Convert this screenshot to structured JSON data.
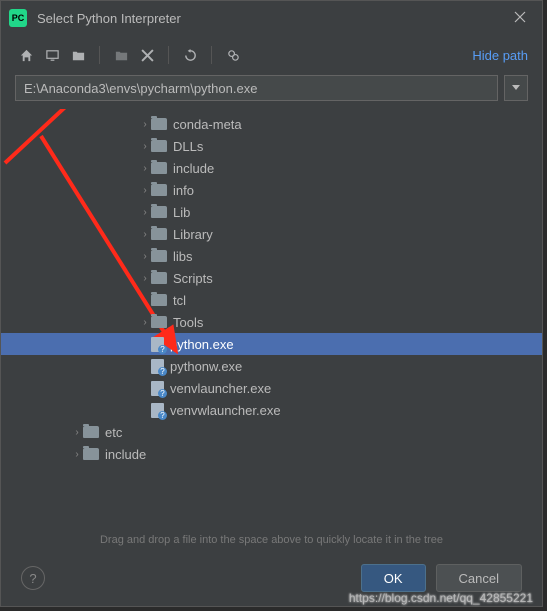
{
  "window": {
    "title": "Select Python Interpreter"
  },
  "toolbar": {
    "hide_path": "Hide path"
  },
  "path": {
    "value": "E:\\Anaconda3\\envs\\pycharm\\python.exe"
  },
  "tree": {
    "items": [
      {
        "depth": 3,
        "expandable": true,
        "icon": "folder",
        "label": "conda-meta",
        "selected": false
      },
      {
        "depth": 3,
        "expandable": true,
        "icon": "folder",
        "label": "DLLs",
        "selected": false
      },
      {
        "depth": 3,
        "expandable": true,
        "icon": "folder",
        "label": "include",
        "selected": false
      },
      {
        "depth": 3,
        "expandable": true,
        "icon": "folder",
        "label": "info",
        "selected": false
      },
      {
        "depth": 3,
        "expandable": true,
        "icon": "folder",
        "label": "Lib",
        "selected": false
      },
      {
        "depth": 3,
        "expandable": true,
        "icon": "folder",
        "label": "Library",
        "selected": false
      },
      {
        "depth": 3,
        "expandable": true,
        "icon": "folder",
        "label": "libs",
        "selected": false
      },
      {
        "depth": 3,
        "expandable": true,
        "icon": "folder",
        "label": "Scripts",
        "selected": false
      },
      {
        "depth": 3,
        "expandable": true,
        "icon": "folder",
        "label": "tcl",
        "selected": false
      },
      {
        "depth": 3,
        "expandable": true,
        "icon": "folder",
        "label": "Tools",
        "selected": false
      },
      {
        "depth": 3,
        "expandable": false,
        "icon": "file",
        "label": "python.exe",
        "selected": true
      },
      {
        "depth": 3,
        "expandable": false,
        "icon": "file",
        "label": "pythonw.exe",
        "selected": false
      },
      {
        "depth": 3,
        "expandable": false,
        "icon": "file",
        "label": "venvlauncher.exe",
        "selected": false
      },
      {
        "depth": 3,
        "expandable": false,
        "icon": "file",
        "label": "venvwlauncher.exe",
        "selected": false
      },
      {
        "depth": 1,
        "expandable": true,
        "icon": "folder",
        "label": "etc",
        "selected": false
      },
      {
        "depth": 1,
        "expandable": true,
        "icon": "folder",
        "label": "include",
        "selected": false
      }
    ],
    "hint": "Drag and drop a file into the space above to quickly locate it in the tree"
  },
  "buttons": {
    "ok": "OK",
    "cancel": "Cancel",
    "help": "?"
  },
  "watermark": "https://blog.csdn.net/qq_42855221",
  "icons": {
    "app": "PC"
  }
}
